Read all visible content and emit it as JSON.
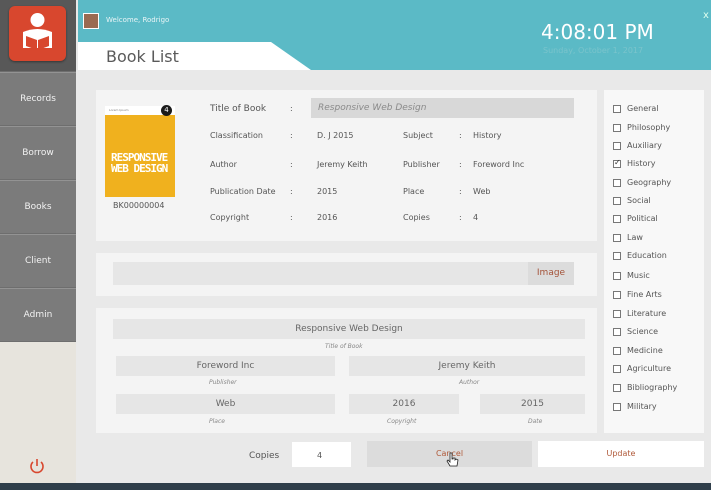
{
  "header": {
    "welcome": "Welcome, Rodrigo",
    "time": "4:08:01 PM",
    "date": "Sunday, October 1, 2017",
    "close": "x",
    "page_title": "Book List"
  },
  "sidebar": {
    "items": [
      {
        "label": "Records"
      },
      {
        "label": "Borrow"
      },
      {
        "label": "Books"
      },
      {
        "label": "Client"
      },
      {
        "label": "Admin"
      }
    ]
  },
  "book": {
    "cover_header": "Lorem Ipsum",
    "cover_title": "RESPONSIVE WEB DESIGN",
    "badge": "4",
    "code": "BK00000004",
    "title_label": "Title of Book",
    "title_value": "Responsive Web Design",
    "classification_label": "Classification",
    "classification_value": "D. J 2015",
    "subject_label": "Subject",
    "subject_value": "History",
    "author_label": "Author",
    "author_value": "Jeremy Keith",
    "publisher_label": "Publisher",
    "publisher_value": "Foreword Inc",
    "pubdate_label": "Publication Date",
    "pubdate_value": "2015",
    "place_label": "Place",
    "place_value": "Web",
    "copyright_label": "Copyright",
    "copyright_value": "2016",
    "copies_label": "Copies",
    "copies_value": "4",
    "colon": ":"
  },
  "image_bar": {
    "button_label": "Image"
  },
  "edit": {
    "title_value": "Responsive Web Design",
    "title_caption": "Title of Book",
    "publisher_value": "Foreword Inc",
    "publisher_caption": "Publisher",
    "author_value": "Jeremy Keith",
    "author_caption": "Author",
    "place_value": "Web",
    "place_caption": "Place",
    "copyright_value": "2016",
    "copyright_caption": "Copyright",
    "date_value": "2015",
    "date_caption": "Date"
  },
  "footer": {
    "copies_label": "Copies",
    "copies_value": "4",
    "cancel_label": "Cancel",
    "update_label": "Update"
  },
  "categories": [
    {
      "label": "General",
      "checked": false
    },
    {
      "label": "Philosophy",
      "checked": false
    },
    {
      "label": "Auxiliary",
      "checked": false
    },
    {
      "label": "History",
      "checked": true
    },
    {
      "label": "Geography",
      "checked": false
    },
    {
      "label": "Social",
      "checked": false
    },
    {
      "label": "Political",
      "checked": false
    },
    {
      "label": "Law",
      "checked": false
    },
    {
      "label": "Education",
      "checked": false
    },
    {
      "label": "Music",
      "checked": false
    },
    {
      "label": "Fine Arts",
      "checked": false
    },
    {
      "label": "Literature",
      "checked": false
    },
    {
      "label": "Science",
      "checked": false
    },
    {
      "label": "Medicine",
      "checked": false
    },
    {
      "label": "Agriculture",
      "checked": false
    },
    {
      "label": "Bibliography",
      "checked": false
    },
    {
      "label": "Military",
      "checked": false
    }
  ],
  "colors": {
    "accent": "#d8472e",
    "header_teal": "#5bbac6",
    "sidebar": "#7b7b7b"
  }
}
